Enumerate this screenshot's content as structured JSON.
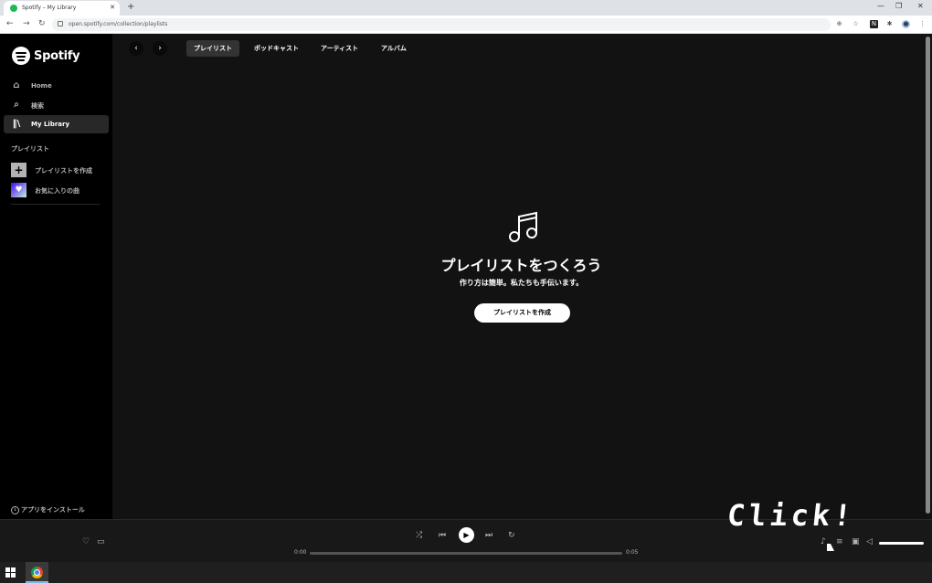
{
  "browser": {
    "tab_title": "Spotify – My Library",
    "tab_close": "✕",
    "new_tab": "+",
    "url": "open.spotify.com/collection/playlists",
    "window_controls": [
      "—",
      "❐",
      "✕"
    ]
  },
  "sidebar": {
    "logo_text": "Spotify",
    "nav": [
      {
        "label": "Home",
        "icon": "home-icon",
        "glyph": "⌂"
      },
      {
        "label": "検索",
        "icon": "search-icon",
        "glyph": "⌕"
      },
      {
        "label": "My Library",
        "icon": "library-icon",
        "glyph": "‖\\",
        "active": true
      }
    ],
    "section_title": "プレイリスト",
    "playlist_actions": [
      {
        "label": "プレイリストを作成",
        "icon": "plus-icon",
        "glyph": "+"
      },
      {
        "label": "お気に入りの曲",
        "icon": "heart-icon",
        "glyph": "♥"
      }
    ],
    "install_label": "アプリをインストール"
  },
  "main": {
    "tabs": [
      "プレイリスト",
      "ポッドキャスト",
      "アーティスト",
      "アルバム"
    ],
    "active_tab": "プレイリスト",
    "empty_state": {
      "icon": "music-note-icon",
      "title": "プレイリストをつくろう",
      "subtitle": "作り方は簡単。私たちも手伝います。",
      "button_label": "プレイリストを作成"
    }
  },
  "player": {
    "time_current": "0:00",
    "time_total": "0:05",
    "progress": 0,
    "volume": 1.0,
    "annotation": "Click!"
  },
  "colors": {
    "accent": "#1db954",
    "background": "#121212",
    "sidebar": "#000000",
    "player": "#181818"
  }
}
